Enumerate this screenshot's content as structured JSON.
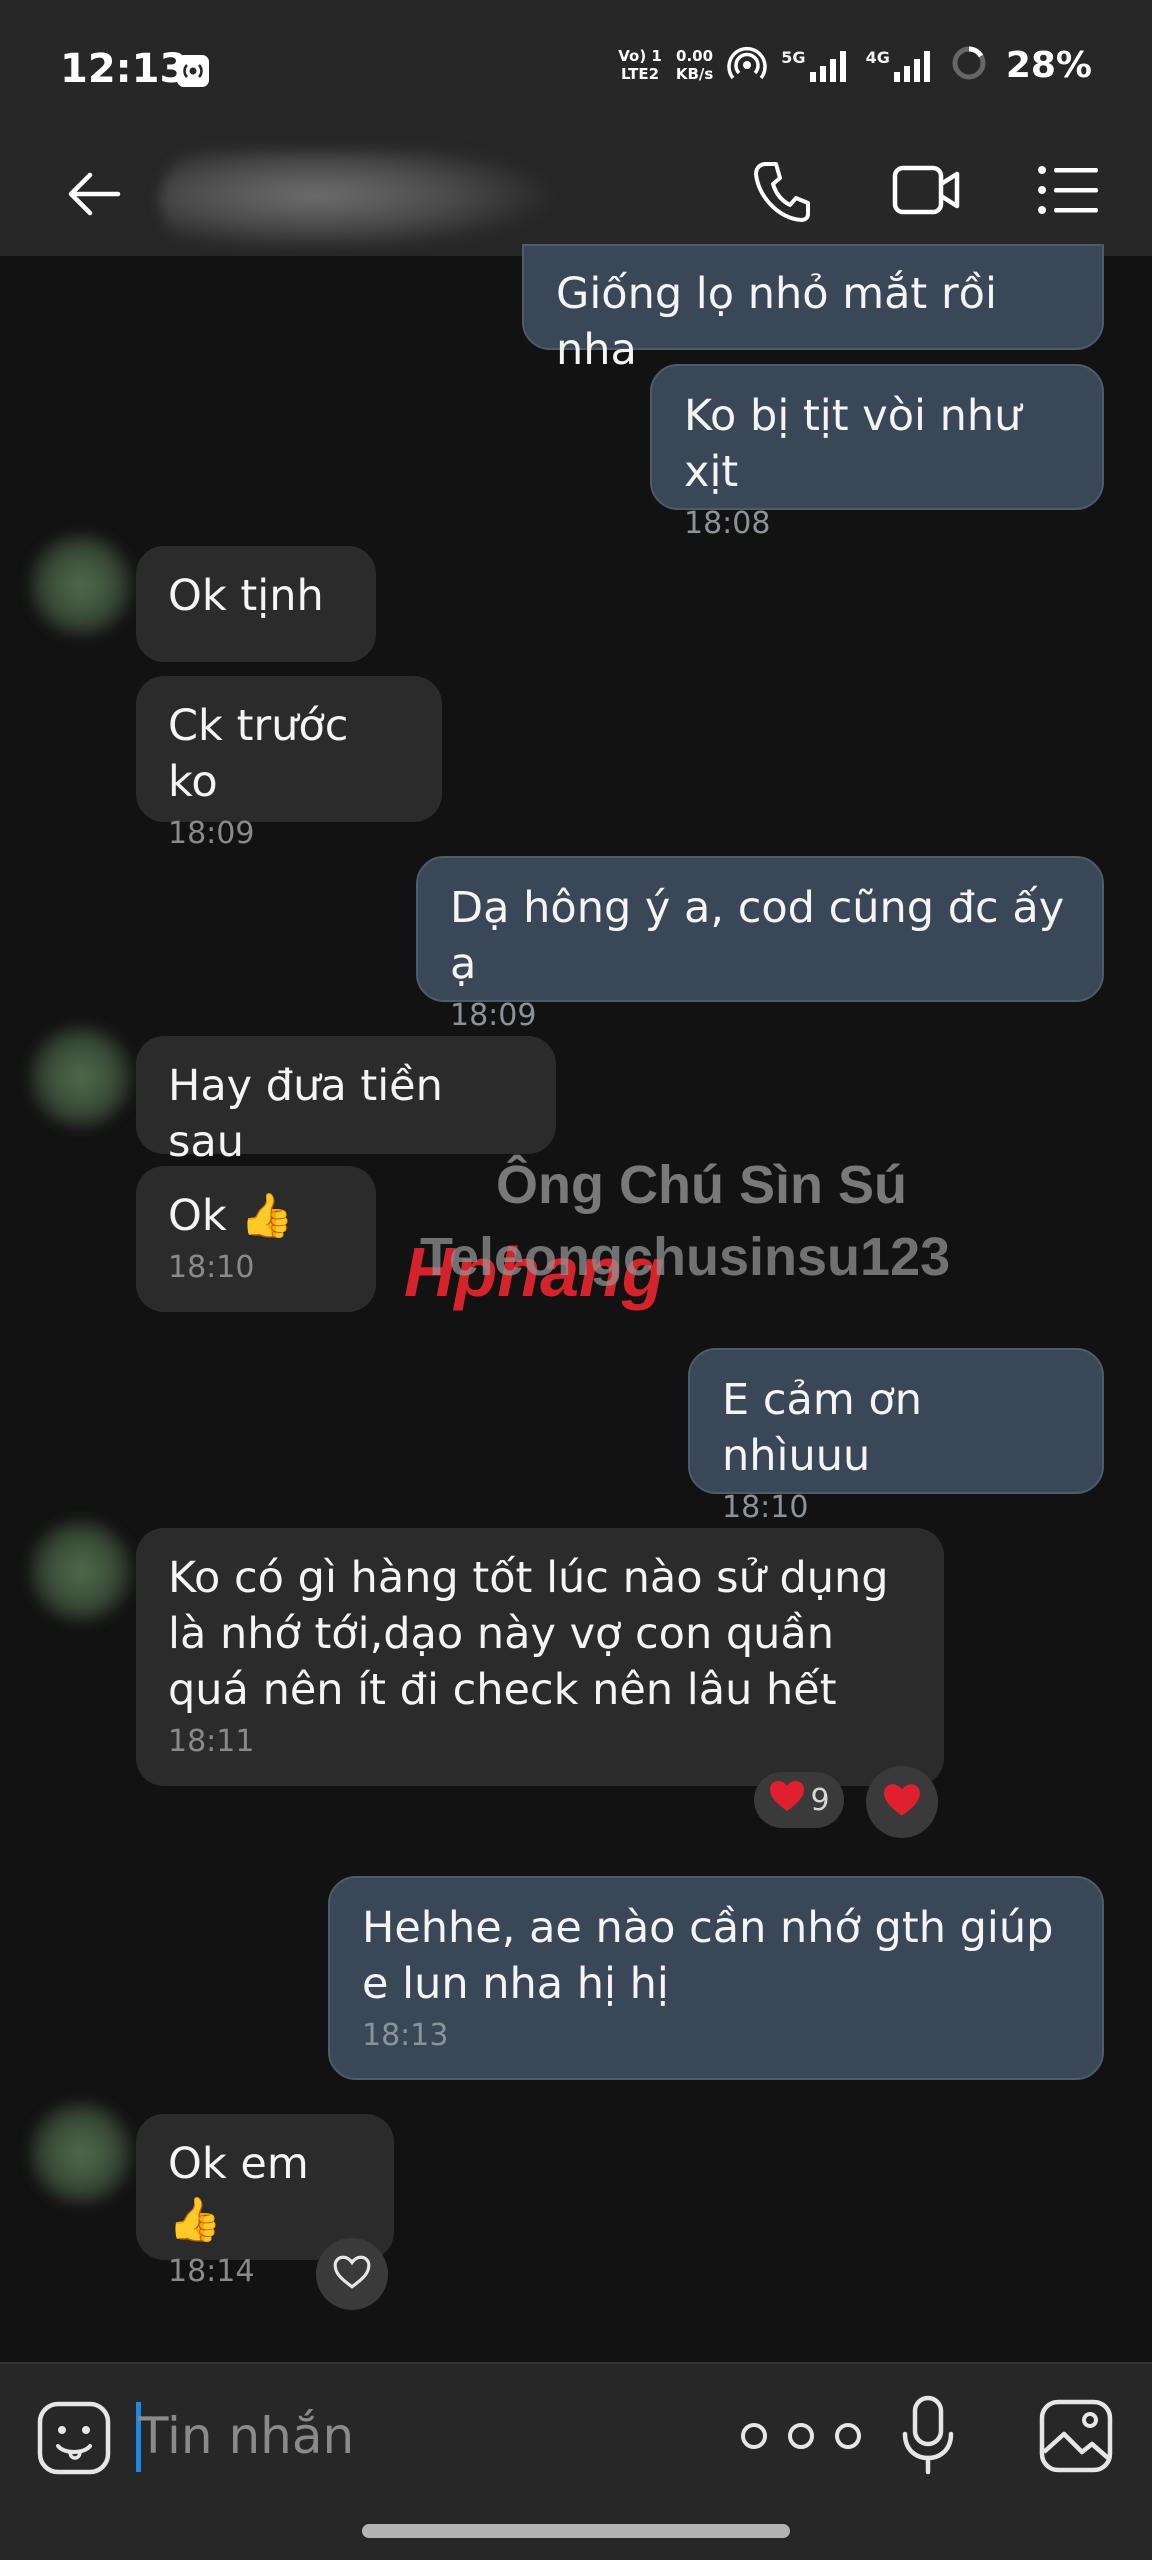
{
  "status_bar": {
    "time": "12:13",
    "net_top": "Vo) 1",
    "net_bottom": "LTE2",
    "speed_top": "0.00",
    "speed_bottom": "KB/s",
    "sig1": "5G",
    "sig2": "4G",
    "battery": "28%"
  },
  "header": {
    "icons": [
      "back-arrow-icon",
      "phone-icon",
      "video-camera-icon",
      "list-menu-icon"
    ]
  },
  "messages": [
    {
      "dir": "out",
      "text": "Giống lọ nhỏ mắt rồi nha",
      "time": ""
    },
    {
      "dir": "out",
      "text": "Ko bị tịt vòi như xịt",
      "time": "18:08"
    },
    {
      "dir": "in",
      "text": "Ok tịnh",
      "time": ""
    },
    {
      "dir": "in",
      "text": "Ck trước ko",
      "time": "18:09"
    },
    {
      "dir": "out",
      "text": "Dạ hông ý a, cod cũng đc ấy ạ",
      "time": "18:09"
    },
    {
      "dir": "in",
      "text": "Hay đưa tiền sau",
      "time": ""
    },
    {
      "dir": "in",
      "text": "Ok 👍",
      "time": "18:10"
    },
    {
      "dir": "out",
      "text": "E cảm ơn nhìuuu",
      "time": "18:10"
    },
    {
      "dir": "in",
      "text": "Ko có gì hàng tốt lúc nào sử dụng là nhớ tới,dạo này vợ con quần quá nên ít đi check nên lâu hết",
      "time": "18:11"
    },
    {
      "dir": "out",
      "text": "Hehhe, ae nào cần nhớ gth giúp e lun nha hị hị",
      "time": "18:13"
    },
    {
      "dir": "in",
      "text": "Ok em👍",
      "time": "18:14"
    }
  ],
  "reactions": {
    "heart_count": "9"
  },
  "watermark": {
    "line1": "Ông Chú Sìn Sú",
    "line2": "Teleongchusinsu123",
    "logo_text": "Hphang"
  },
  "composer": {
    "placeholder": "Tin nhắn"
  },
  "colors": {
    "background": "#121212",
    "incoming_bubble": "#2b2b2b",
    "outgoing_bubble": "#3a4757",
    "cursor": "#1e88e5",
    "heart": "#e0202e"
  }
}
